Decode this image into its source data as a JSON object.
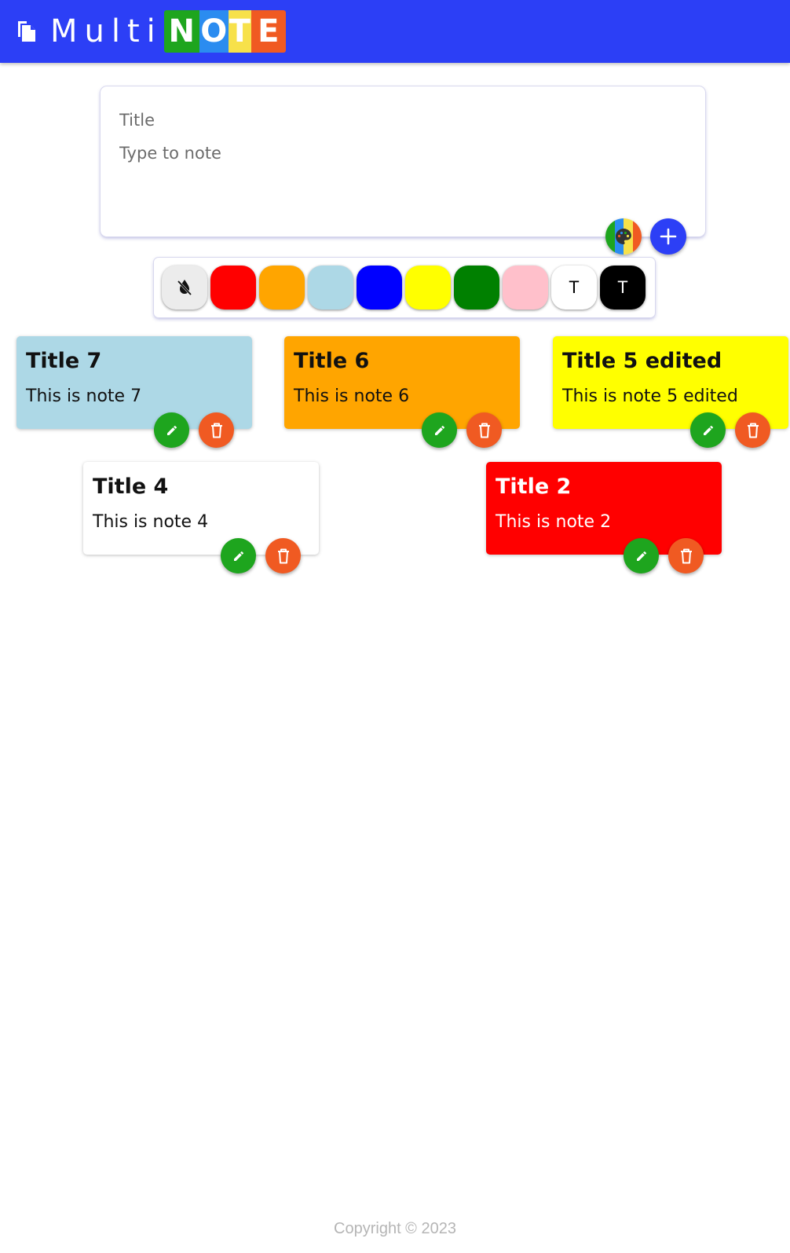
{
  "header": {
    "brand_prefix": "Multi",
    "brand_letters": [
      {
        "char": "N",
        "color": "#1ea51e"
      },
      {
        "char": "O",
        "color": "#2b8cf0"
      },
      {
        "char": "T",
        "color": "#f7e14a"
      },
      {
        "char": "E",
        "color": "#f05a22"
      }
    ],
    "logo_icon": "copy-notes-icon",
    "background": "#2c3ff6"
  },
  "composer": {
    "title_placeholder": "Title",
    "body_placeholder": "Type to note",
    "palette_icon": "palette-icon",
    "add_icon": "plus-icon",
    "palette_stripes": [
      "#1ea51e",
      "#2b8cf0",
      "#f7e14a",
      "#f05a22"
    ]
  },
  "color_picker": {
    "swatches": [
      {
        "name": "no-color",
        "color": "#ececec",
        "icon": "no-color-drop-icon",
        "label": ""
      },
      {
        "name": "red",
        "color": "#ff0000",
        "label": ""
      },
      {
        "name": "orange",
        "color": "#ffa500",
        "label": ""
      },
      {
        "name": "lightblue",
        "color": "#add8e6",
        "label": ""
      },
      {
        "name": "blue",
        "color": "#0000ff",
        "label": ""
      },
      {
        "name": "yellow",
        "color": "#ffff00",
        "label": ""
      },
      {
        "name": "green",
        "color": "#008000",
        "label": ""
      },
      {
        "name": "pink",
        "color": "#ffc0cb",
        "label": ""
      },
      {
        "name": "text-dark",
        "color": "#ffffff",
        "text_color": "#000000",
        "label": "T"
      },
      {
        "name": "text-light",
        "color": "#000000",
        "text_color": "#ffffff",
        "label": "T"
      }
    ]
  },
  "notes": [
    {
      "title": "Title 7",
      "body": "This is note 7",
      "bg": "#add8e6",
      "fg": "#111111"
    },
    {
      "title": "Title 6",
      "body": "This is note 6",
      "bg": "#ffa500",
      "fg": "#111111"
    },
    {
      "title": "Title 5 edited",
      "body": "This is note 5 edited",
      "bg": "#ffff00",
      "fg": "#111111"
    },
    {
      "title": "Title 4",
      "body": "This is note 4",
      "bg": "#ffffff",
      "fg": "#111111"
    },
    {
      "title": "Title 2",
      "body": "This is note 2",
      "bg": "#ff0000",
      "fg": "#ffffff"
    }
  ],
  "note_actions": {
    "edit_icon": "pencil-icon",
    "delete_icon": "trash-icon"
  },
  "footer": {
    "text": "Copyright © 2023"
  }
}
